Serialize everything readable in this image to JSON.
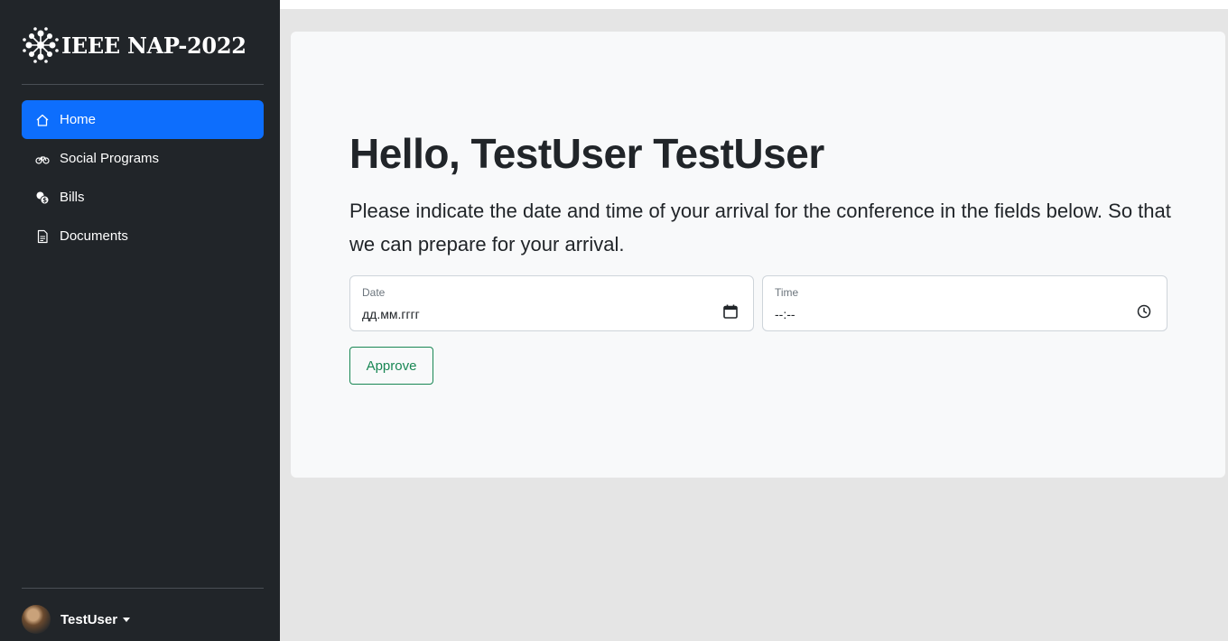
{
  "sidebar": {
    "brand": "IEEE NAP-2022",
    "items": [
      {
        "label": "Home",
        "icon": "home-icon",
        "active": true
      },
      {
        "label": "Social Programs",
        "icon": "bicycle-icon",
        "active": false
      },
      {
        "label": "Bills",
        "icon": "coins-icon",
        "active": false
      },
      {
        "label": "Documents",
        "icon": "document-icon",
        "active": false
      }
    ],
    "user": {
      "name": "TestUser"
    }
  },
  "main": {
    "greeting": "Hello, TestUser TestUser",
    "lead": "Please indicate the date and time of your arrival for the conference in the fields below. So that we can prepare for your arrival.",
    "date_field": {
      "label": "Date",
      "value": "дд.мм.гггг"
    },
    "time_field": {
      "label": "Time",
      "value": "--:--"
    },
    "approve_label": "Approve"
  },
  "colors": {
    "sidebar_bg": "#212529",
    "active_nav": "#0d6efd",
    "button_outline": "#198754",
    "card_bg": "#f8f9fa",
    "page_bg": "#e5e5e5"
  }
}
